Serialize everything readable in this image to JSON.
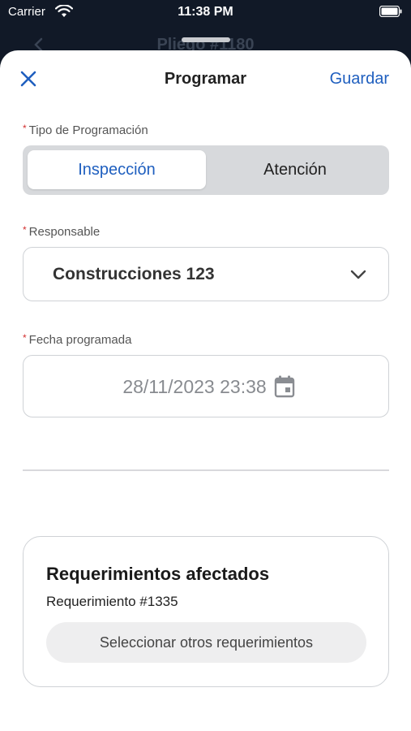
{
  "status_bar": {
    "carrier": "Carrier",
    "time": "11:38 PM"
  },
  "background_screen": {
    "title": "Pliego #1180"
  },
  "nav": {
    "title": "Programar",
    "save_label": "Guardar",
    "close_icon": "close-icon"
  },
  "tipo_programacion": {
    "label": "Tipo de Programación",
    "required_mark": "*",
    "options": [
      "Inspección",
      "Atención"
    ],
    "selected": "Inspección"
  },
  "responsable": {
    "label": "Responsable",
    "required_mark": "*",
    "value": "Construcciones 123",
    "icon": "chevron-down-icon"
  },
  "fecha": {
    "label": "Fecha programada",
    "required_mark": "*",
    "value": "28/11/2023 23:38",
    "icon": "calendar-icon"
  },
  "requerimientos": {
    "title": "Requerimientos afectados",
    "item": "Requerimiento #1335",
    "button_label": "Seleccionar otros requerimientos"
  },
  "colors": {
    "accent": "#1f5fbf",
    "required": "#d32f2f",
    "backdrop": "#111927"
  }
}
